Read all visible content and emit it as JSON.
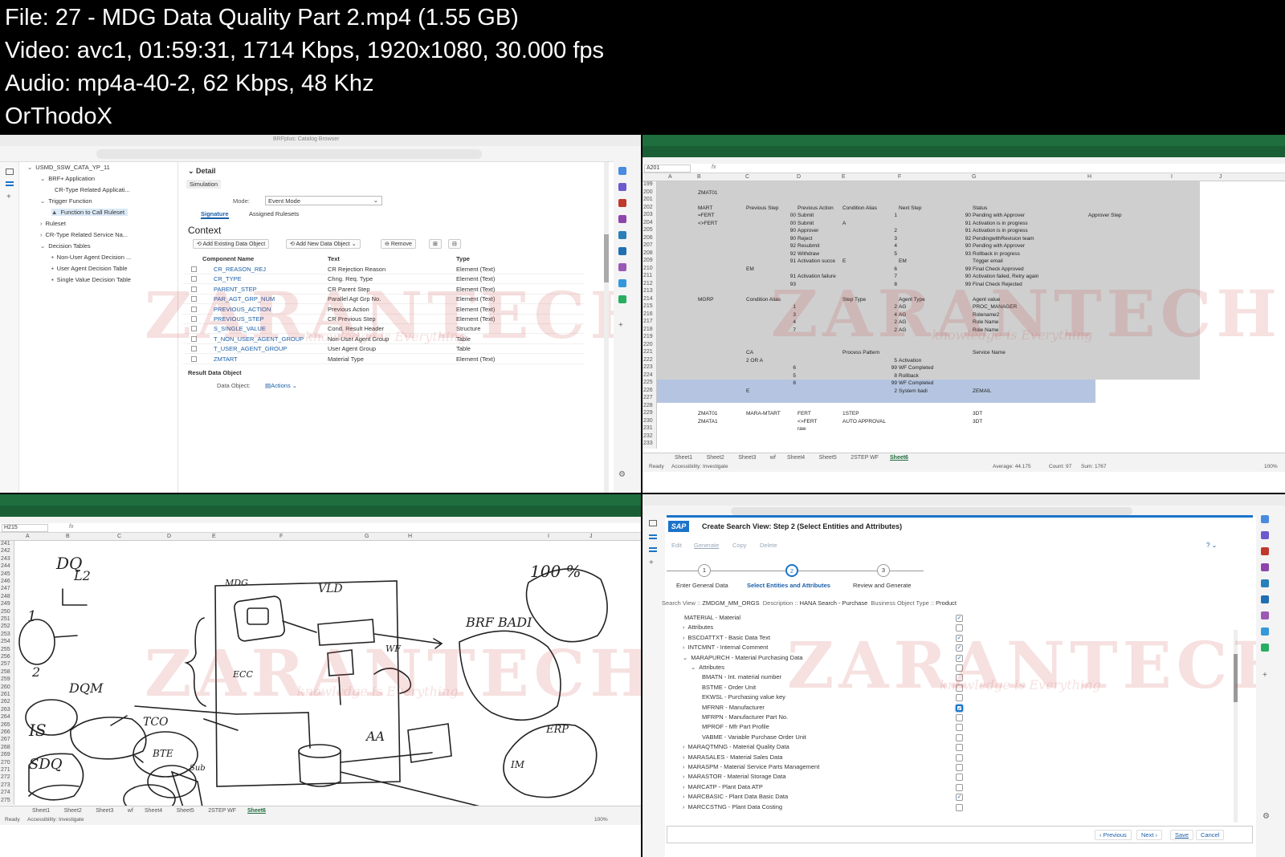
{
  "info": {
    "line1": "File: 27 - MDG Data Quality Part 2.mp4 (1.55 GB)",
    "line2": "Video: avc1, 01:59:31, 1714 Kbps, 1920x1080, 30.000 fps",
    "line3": "Audio: mp4a-40-2, 62 Kbps, 48 Khz",
    "line4": "OrThodoX"
  },
  "brf": {
    "window_title": "BRFplus: Catalog Browser",
    "tree": [
      {
        "label": "USMD_SSW_CATA_YP_11",
        "sel": false
      },
      {
        "label": "BRF+ Application",
        "sel": false
      },
      {
        "label": "CR-Type Related Applicati...",
        "sel": false
      },
      {
        "label": "Trigger Function",
        "sel": false
      },
      {
        "label": "Function to Call Ruleset",
        "sel": true
      },
      {
        "label": "Ruleset",
        "sel": false
      },
      {
        "label": "CR-Type Related Service Na...",
        "sel": false
      },
      {
        "label": "Decision Tables",
        "sel": false
      },
      {
        "label": "Non-User Agent Decision ...",
        "sel": false
      },
      {
        "label": "User Agent Decision Table",
        "sel": false
      },
      {
        "label": "Single Value Decision Table",
        "sel": false
      }
    ],
    "detail_title": "Detail",
    "simulation_tab": "Simulation",
    "mode_label": "Mode:",
    "mode_value": "Event Mode",
    "tabs": [
      "Signature",
      "Assigned Rulesets"
    ],
    "context_title": "Context",
    "toolbar": {
      "add_existing": "Add Existing Data Object",
      "add_new": "Add New Data Object",
      "remove": "Remove"
    },
    "columns": [
      "Component Name",
      "Text",
      "Type"
    ],
    "rows": [
      {
        "name": "CR_REASON_REJ",
        "text": "CR Rejection Reason",
        "type": "Element (Text)"
      },
      {
        "name": "CR_TYPE",
        "text": "Chng. Req. Type",
        "type": "Element (Text)"
      },
      {
        "name": "PARENT_STEP",
        "text": "CR Parent Step",
        "type": "Element (Text)"
      },
      {
        "name": "PAR_AGT_GRP_NUM",
        "text": "Parallel Agt Grp No.",
        "type": "Element (Text)"
      },
      {
        "name": "PREVIOUS_ACTION",
        "text": "Previous Action",
        "type": "Element (Text)"
      },
      {
        "name": "PREVIOUS_STEP",
        "text": "CR Previous Step",
        "type": "Element (Text)"
      },
      {
        "name": "S_SINGLE_VALUE",
        "text": "Cond. Result Header",
        "type": "Structure"
      },
      {
        "name": "T_NON_USER_AGENT_GROUP",
        "text": "Non-User Agent Group",
        "type": "Table"
      },
      {
        "name": "T_USER_AGENT_GROUP",
        "text": "User Agent Group",
        "type": "Table"
      },
      {
        "name": "ZMTART",
        "text": "Material Type",
        "type": "Element (Text)"
      }
    ],
    "result_label": "Result Data Object",
    "data_object_label": "Data Object:",
    "actions_label": "Actions"
  },
  "excel1": {
    "cell_ref": "A201",
    "fx": "fx",
    "columns": [
      "A",
      "B",
      "C",
      "D",
      "E",
      "F",
      "G",
      "H",
      "I",
      "J"
    ],
    "row_start": 199,
    "row_end": 233,
    "sheets": [
      "Sheet1",
      "Sheet2",
      "Sheet3",
      "wf",
      "Sheet4",
      "Sheet5",
      "2STEP WF",
      "Sheet6"
    ],
    "active_sheet": "Sheet6",
    "status_ready": "Ready",
    "status_access": "Accessibility: Investigate",
    "status_avg": "Average: 44.175",
    "status_count": "Count: 97",
    "status_sum": "Sum: 1767",
    "zoom": "100%",
    "cells": [
      {
        "r": 200,
        "c": "B",
        "v": "ZMAT01"
      },
      {
        "r": 202,
        "c": "B",
        "v": "MART"
      },
      {
        "r": 202,
        "c": "C",
        "v": "Previous Step"
      },
      {
        "r": 202,
        "c": "D",
        "v": "Previous Action"
      },
      {
        "r": 202,
        "c": "E",
        "v": "Condition Alias"
      },
      {
        "r": 202,
        "c": "F",
        "v": "Next Step"
      },
      {
        "r": 202,
        "c": "G",
        "v": "Status"
      },
      {
        "r": 203,
        "c": "B",
        "v": "=FERT"
      },
      {
        "r": 203,
        "c": "C",
        "v": "00"
      },
      {
        "r": 203,
        "c": "D",
        "v": "Submit"
      },
      {
        "r": 203,
        "c": "E",
        "v": "1"
      },
      {
        "r": 203,
        "c": "F",
        "v": "90"
      },
      {
        "r": 203,
        "c": "G",
        "v": "Pending with Approver"
      },
      {
        "r": 203,
        "c": "H",
        "v": "Approver Step"
      },
      {
        "r": 204,
        "c": "B",
        "v": "<>FERT"
      },
      {
        "r": 204,
        "c": "C",
        "v": "00"
      },
      {
        "r": 204,
        "c": "D",
        "v": "Submit"
      },
      {
        "r": 204,
        "c": "E",
        "v": "A"
      },
      {
        "r": 204,
        "c": "F",
        "v": "91"
      },
      {
        "r": 204,
        "c": "G",
        "v": "Activation is in progress"
      },
      {
        "r": 205,
        "c": "C",
        "v": "90"
      },
      {
        "r": 205,
        "c": "D",
        "v": "Approver"
      },
      {
        "r": 205,
        "c": "E",
        "v": "2"
      },
      {
        "r": 205,
        "c": "F",
        "v": "91"
      },
      {
        "r": 205,
        "c": "G",
        "v": "Activation is in progress"
      },
      {
        "r": 206,
        "c": "C",
        "v": "90"
      },
      {
        "r": 206,
        "c": "D",
        "v": "Reject"
      },
      {
        "r": 206,
        "c": "E",
        "v": "3"
      },
      {
        "r": 206,
        "c": "F",
        "v": "92"
      },
      {
        "r": 206,
        "c": "G",
        "v": "PendingwithRevision team"
      },
      {
        "r": 207,
        "c": "C",
        "v": "92"
      },
      {
        "r": 207,
        "c": "D",
        "v": "Resubmit"
      },
      {
        "r": 207,
        "c": "E",
        "v": "4"
      },
      {
        "r": 207,
        "c": "F",
        "v": "90"
      },
      {
        "r": 207,
        "c": "G",
        "v": "Pending with Approver"
      },
      {
        "r": 208,
        "c": "C",
        "v": "92"
      },
      {
        "r": 208,
        "c": "D",
        "v": "Withdraw"
      },
      {
        "r": 208,
        "c": "E",
        "v": "5"
      },
      {
        "r": 208,
        "c": "F",
        "v": "93"
      },
      {
        "r": 208,
        "c": "G",
        "v": "Rollback in progress"
      },
      {
        "r": 209,
        "c": "C",
        "v": "91"
      },
      {
        "r": 209,
        "c": "D",
        "v": "Activation succe"
      },
      {
        "r": 209,
        "c": "E",
        "v": "E"
      },
      {
        "r": 209,
        "c": "F",
        "v": "EM"
      },
      {
        "r": 209,
        "c": "G",
        "v": "Trigger email"
      },
      {
        "r": 210,
        "c": "C",
        "v": "EM"
      },
      {
        "r": 210,
        "c": "E",
        "v": "6"
      },
      {
        "r": 210,
        "c": "F",
        "v": "99"
      },
      {
        "r": 210,
        "c": "G",
        "v": "Final Check Approved"
      },
      {
        "r": 211,
        "c": "C",
        "v": "91"
      },
      {
        "r": 211,
        "c": "D",
        "v": "Activation failure"
      },
      {
        "r": 211,
        "c": "E",
        "v": "7"
      },
      {
        "r": 211,
        "c": "F",
        "v": "90"
      },
      {
        "r": 211,
        "c": "G",
        "v": "Activation failed, Retry again"
      },
      {
        "r": 212,
        "c": "C",
        "v": "93"
      },
      {
        "r": 212,
        "c": "E",
        "v": "8"
      },
      {
        "r": 212,
        "c": "F",
        "v": "99"
      },
      {
        "r": 212,
        "c": "G",
        "v": "Final Check Rejected"
      },
      {
        "r": 214,
        "c": "B",
        "v": "MGRP"
      },
      {
        "r": 214,
        "c": "C",
        "v": "Condition Alias"
      },
      {
        "r": 214,
        "c": "E",
        "v": "Step Type"
      },
      {
        "r": 214,
        "c": "F",
        "v": "Agent Type"
      },
      {
        "r": 214,
        "c": "G",
        "v": "Agent value"
      },
      {
        "r": 215,
        "c": "C",
        "v": "1"
      },
      {
        "r": 215,
        "c": "E",
        "v": "2"
      },
      {
        "r": 215,
        "c": "F",
        "v": "AG"
      },
      {
        "r": 215,
        "c": "G",
        "v": "PROC_MANAGER"
      },
      {
        "r": 216,
        "c": "C",
        "v": "3"
      },
      {
        "r": 216,
        "c": "E",
        "v": "4"
      },
      {
        "r": 216,
        "c": "F",
        "v": "AG"
      },
      {
        "r": 216,
        "c": "G",
        "v": "Rolename2"
      },
      {
        "r": 217,
        "c": "C",
        "v": "4"
      },
      {
        "r": 217,
        "c": "E",
        "v": "2"
      },
      {
        "r": 217,
        "c": "F",
        "v": "AG"
      },
      {
        "r": 217,
        "c": "G",
        "v": "Role Name"
      },
      {
        "r": 218,
        "c": "C",
        "v": "7"
      },
      {
        "r": 218,
        "c": "E",
        "v": "2"
      },
      {
        "r": 218,
        "c": "F",
        "v": "AG"
      },
      {
        "r": 218,
        "c": "G",
        "v": "Role Name"
      },
      {
        "r": 221,
        "c": "C",
        "v": "CA"
      },
      {
        "r": 221,
        "c": "E",
        "v": "Process Pattern"
      },
      {
        "r": 221,
        "c": "G",
        "v": "Service Name"
      },
      {
        "r": 222,
        "c": "C",
        "v": "2 OR A"
      },
      {
        "r": 222,
        "c": "E",
        "v": "5"
      },
      {
        "r": 222,
        "c": "F",
        "v": "Activation"
      },
      {
        "r": 223,
        "c": "C",
        "v": "6"
      },
      {
        "r": 223,
        "c": "E",
        "v": "99"
      },
      {
        "r": 223,
        "c": "F",
        "v": "WF Completed"
      },
      {
        "r": 224,
        "c": "C",
        "v": "5"
      },
      {
        "r": 224,
        "c": "E",
        "v": "8"
      },
      {
        "r": 224,
        "c": "F",
        "v": "Rollback"
      },
      {
        "r": 225,
        "c": "C",
        "v": "8"
      },
      {
        "r": 225,
        "c": "E",
        "v": "99"
      },
      {
        "r": 225,
        "c": "F",
        "v": "WF Completed"
      },
      {
        "r": 226,
        "c": "C",
        "v": "E"
      },
      {
        "r": 226,
        "c": "E",
        "v": "2"
      },
      {
        "r": 226,
        "c": "F",
        "v": "System badi"
      },
      {
        "r": 226,
        "c": "G",
        "v": "ZEMAIL"
      },
      {
        "r": 229,
        "c": "B",
        "v": "ZMAT01"
      },
      {
        "r": 229,
        "c": "C",
        "v": "MARA-MTART"
      },
      {
        "r": 229,
        "c": "D",
        "v": "FERT"
      },
      {
        "r": 229,
        "c": "E",
        "v": "1STEP"
      },
      {
        "r": 229,
        "c": "G",
        "v": "3DT"
      },
      {
        "r": 230,
        "c": "B",
        "v": "ZMATA1"
      },
      {
        "r": 230,
        "c": "D",
        "v": "<>FERT"
      },
      {
        "r": 230,
        "c": "E",
        "v": "AUTO APPROVAL"
      },
      {
        "r": 230,
        "c": "G",
        "v": "3DT"
      },
      {
        "r": 231,
        "c": "D",
        "v": "raw"
      }
    ]
  },
  "excel2": {
    "cell_ref": "H215",
    "fx": "fx",
    "columns": [
      "A",
      "B",
      "C",
      "D",
      "E",
      "F",
      "G",
      "H",
      "I",
      "J"
    ],
    "row_start": 241,
    "row_end": 275,
    "sheets": [
      "Sheet1",
      "Sheet2",
      "Sheet3",
      "wf",
      "Sheet4",
      "Sheet5",
      "2STEP WF",
      "Sheet6"
    ],
    "active_sheet": "Sheet6",
    "status_ready": "Ready",
    "status_access": "Accessibility: Investigate",
    "zoom": "100%",
    "handwriting": [
      "DQ",
      "L2",
      "1",
      "2",
      "DQM",
      "IS",
      "SDQ",
      "MDG",
      "VLD",
      "BRF BADI",
      "100 %",
      "ECC",
      "AA",
      "ERP",
      "WF",
      "TCO",
      "BTE",
      "Sub",
      "IM"
    ]
  },
  "sap": {
    "logo": "SAP",
    "title": "Create Search View: Step 2  (Select Entities and Attributes)",
    "actions": [
      "Edit",
      "Generate",
      "Copy",
      "Delete"
    ],
    "steps": [
      {
        "num": "1",
        "label": "Enter General Data"
      },
      {
        "num": "2",
        "label": "Select Entities and Attributes"
      },
      {
        "num": "3",
        "label": "Review and Generate"
      }
    ],
    "search_view_label": "Search View ::",
    "search_view_value": "ZMDGM_MM_ORGS",
    "description_label": "Description ::",
    "description_value": "HANA Search - Purchase",
    "bo_type_label": "Business Object Type ::",
    "bo_type_value": "Product",
    "entities": [
      {
        "label": "MATERIAL - Material",
        "arrow": "",
        "level": 0,
        "checked": true
      },
      {
        "label": "Attributes",
        "arrow": "›",
        "level": 1,
        "checked": false
      },
      {
        "label": "BSCDATTXT - Basic Data Text",
        "arrow": "›",
        "level": 1,
        "checked": true
      },
      {
        "label": "INTCMNT - Internal Comment",
        "arrow": "›",
        "level": 1,
        "checked": true
      },
      {
        "label": "MARAPURCH - Material Purchasing Data",
        "arrow": "⌄",
        "level": 1,
        "checked": true
      },
      {
        "label": "Attributes",
        "arrow": "⌄",
        "level": 2,
        "checked": false
      },
      {
        "label": "BMATN - Int. material number",
        "arrow": "",
        "level": 3,
        "checked": false
      },
      {
        "label": "BSTME - Order Unit",
        "arrow": "",
        "level": 3,
        "checked": false
      },
      {
        "label": "EKWSL - Purchasing value key",
        "arrow": "",
        "level": 3,
        "checked": false
      },
      {
        "label": "MFRNR - Manufacturer",
        "arrow": "",
        "level": 3,
        "checked": true,
        "highlight": true
      },
      {
        "label": "MFRPN - Manufacturer Part No.",
        "arrow": "",
        "level": 3,
        "checked": false
      },
      {
        "label": "MPROF - Mfr Part Profile",
        "arrow": "",
        "level": 3,
        "checked": false
      },
      {
        "label": "VABME - Variable Purchase Order Unit",
        "arrow": "",
        "level": 3,
        "checked": false
      },
      {
        "label": "MARAQTMNG - Material Quality Data",
        "arrow": "›",
        "level": 1,
        "checked": false
      },
      {
        "label": "MARASALES - Material Sales Data",
        "arrow": "›",
        "level": 1,
        "checked": false
      },
      {
        "label": "MARASPM - Material Service Parts Management",
        "arrow": "›",
        "level": 1,
        "checked": false
      },
      {
        "label": "MARASTOR - Material Storage Data",
        "arrow": "›",
        "level": 1,
        "checked": false
      },
      {
        "label": "MARCATP - Plant Data ATP",
        "arrow": "›",
        "level": 1,
        "checked": false
      },
      {
        "label": "MARCBASIC - Plant Data Basic Data",
        "arrow": "›",
        "level": 1,
        "checked": true
      },
      {
        "label": "MARCCSTNG - Plant Data Costing",
        "arrow": "›",
        "level": 1,
        "checked": false
      }
    ],
    "footer": {
      "previous": "‹ Previous",
      "next": "Next ›",
      "save": "Save",
      "cancel": "Cancel"
    }
  },
  "watermark": {
    "brand": "ZARANTECH",
    "tagline": "knowledge is Everything"
  },
  "colors": {
    "sap_blue": "#1a73c9",
    "excel_green": "#1e6e3e",
    "selection": "#a8a8a8"
  }
}
